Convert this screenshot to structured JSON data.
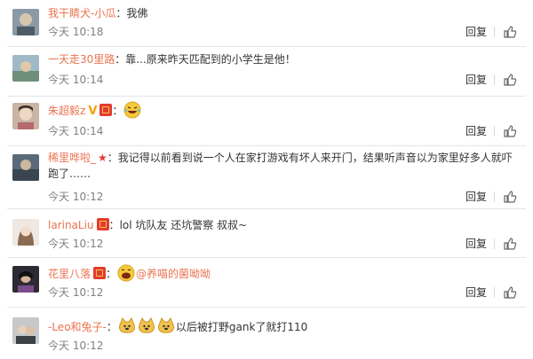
{
  "actions": {
    "reply_label": "回复"
  },
  "comments": [
    {
      "user": "我干睛犬-小瓜",
      "time": "今天 10:18",
      "text": "我佛"
    },
    {
      "user": "一天走30里路",
      "time": "今天 10:14",
      "text": "靠...原来昨天匹配到的小学生是他！"
    },
    {
      "user": "朱超毅z",
      "time": "今天 10:14",
      "text": ""
    },
    {
      "user": "稀里哗啦_",
      "time": "今天 10:12",
      "text": "我记得以前看到说一个人在家打游戏有坏人来开门，结果听声音以为家里好多人就吓跑了……"
    },
    {
      "user": "larinaLiu",
      "time": "今天 10:12",
      "text": "lol 坑队友 还坑警察 叔叔~"
    },
    {
      "user": "花里八落",
      "time": "今天 10:12",
      "text": "",
      "mention": "@养喵的菌呦呦"
    },
    {
      "user": "-Leo和兔子-",
      "time": "今天 10:12",
      "text": "以后被打野gank了就打110"
    }
  ],
  "colors": {
    "username": "#eb7350",
    "time": "#808080",
    "badge": "#e33b2f"
  }
}
